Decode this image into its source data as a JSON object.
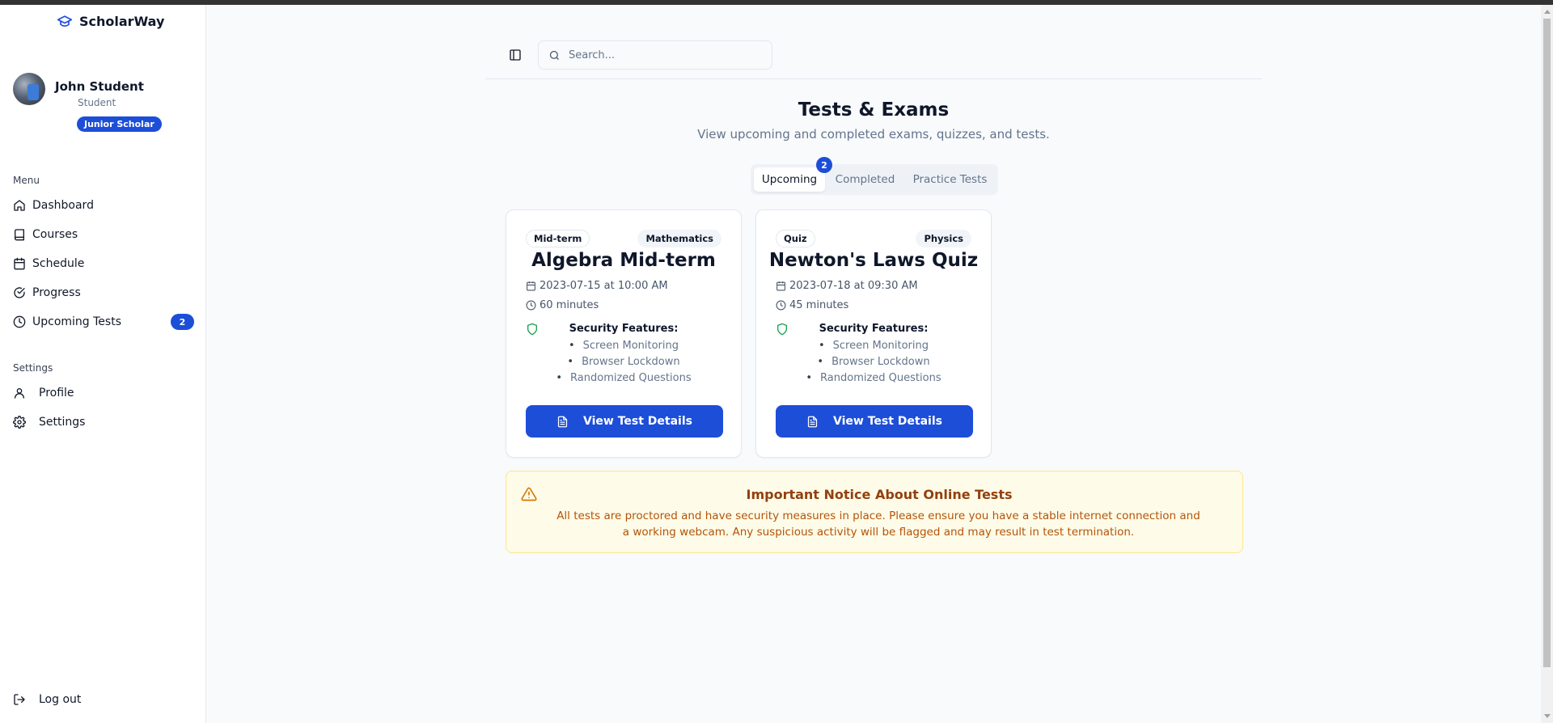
{
  "app": {
    "name": "ScholarWay"
  },
  "user": {
    "name": "John Student",
    "role": "Student",
    "level": "Junior Scholar"
  },
  "sidebar": {
    "menu_label": "Menu",
    "menu_items": [
      {
        "label": "Dashboard",
        "icon": "home-icon"
      },
      {
        "label": "Courses",
        "icon": "book-icon"
      },
      {
        "label": "Schedule",
        "icon": "calendar-icon"
      },
      {
        "label": "Progress",
        "icon": "check-circle-icon"
      },
      {
        "label": "Upcoming Tests",
        "icon": "clock-icon",
        "count": "2"
      }
    ],
    "settings_label": "Settings",
    "settings_items": [
      {
        "label": "Profile",
        "icon": "user-icon"
      },
      {
        "label": "Settings",
        "icon": "gear-icon"
      }
    ],
    "logout_label": "Log out"
  },
  "header": {
    "search_placeholder": "Search..."
  },
  "page": {
    "title": "Tests & Exams",
    "subtitle": "View upcoming and completed exams, quizzes, and tests."
  },
  "tabs": [
    {
      "label": "Upcoming",
      "badge": "2",
      "active": true
    },
    {
      "label": "Completed"
    },
    {
      "label": "Practice Tests"
    }
  ],
  "tests": [
    {
      "type": "Mid-term",
      "subject": "Mathematics",
      "title": "Algebra Mid-term",
      "datetime": "2023-07-15 at 10:00 AM",
      "duration": "60 minutes",
      "security_heading": "Security Features:",
      "security_features": [
        "Screen Monitoring",
        "Browser Lockdown",
        "Randomized Questions"
      ],
      "button_label": "View Test Details"
    },
    {
      "type": "Quiz",
      "subject": "Physics",
      "title": "Newton's Laws Quiz",
      "datetime": "2023-07-18 at 09:30 AM",
      "duration": "45 minutes",
      "security_heading": "Security Features:",
      "security_features": [
        "Screen Monitoring",
        "Browser Lockdown",
        "Randomized Questions"
      ],
      "button_label": "View Test Details"
    }
  ],
  "notice": {
    "title": "Important Notice About Online Tests",
    "text": "All tests are proctored and have security measures in place. Please ensure you have a stable internet connection and a working webcam. Any suspicious activity will be flagged and may result in test termination."
  },
  "colors": {
    "accent": "#1d4ed8",
    "notice_bg": "#fefce8",
    "notice_text": "#b45309",
    "shield": "#16a34a",
    "warning": "#d97706"
  }
}
